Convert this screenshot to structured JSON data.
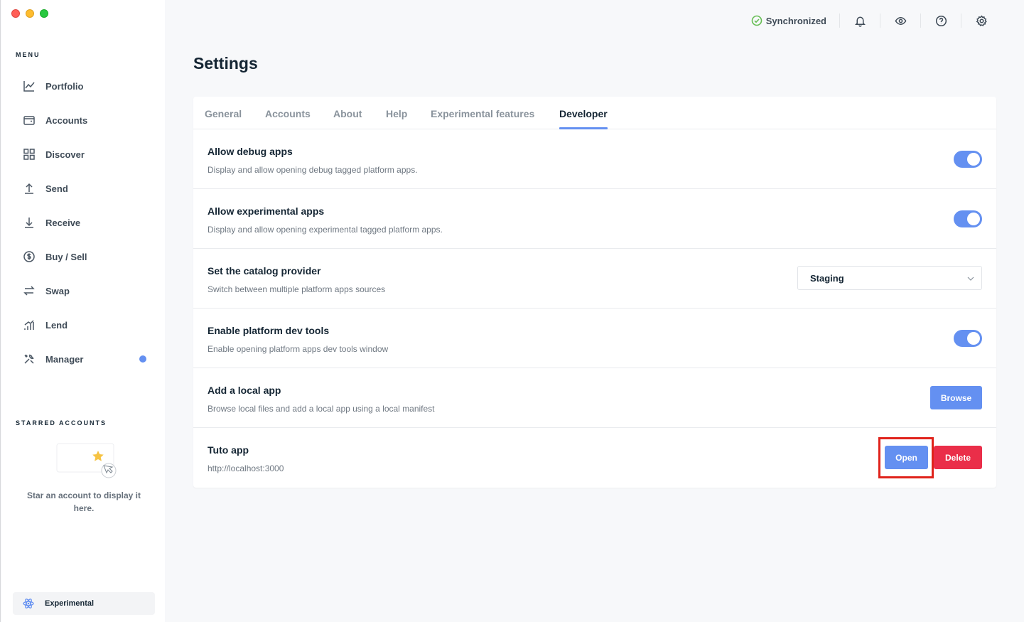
{
  "sidebar": {
    "menu_title": "MENU",
    "items": [
      {
        "label": "Portfolio",
        "icon": "chart-icon"
      },
      {
        "label": "Accounts",
        "icon": "wallet-icon"
      },
      {
        "label": "Discover",
        "icon": "grid-icon"
      },
      {
        "label": "Send",
        "icon": "arrow-up-icon"
      },
      {
        "label": "Receive",
        "icon": "arrow-down-icon"
      },
      {
        "label": "Buy / Sell",
        "icon": "dollar-icon"
      },
      {
        "label": "Swap",
        "icon": "swap-icon"
      },
      {
        "label": "Lend",
        "icon": "lend-icon"
      },
      {
        "label": "Manager",
        "icon": "tools-icon"
      }
    ],
    "starred_title": "STARRED ACCOUNTS",
    "starred_empty_text": "Star an account to display it here.",
    "experimental_label": "Experimental"
  },
  "topbar": {
    "sync_label": "Synchronized"
  },
  "page": {
    "title": "Settings"
  },
  "tabs": [
    "General",
    "Accounts",
    "About",
    "Help",
    "Experimental features",
    "Developer"
  ],
  "active_tab": "Developer",
  "rows": {
    "debug": {
      "title": "Allow debug apps",
      "desc": "Display and allow opening debug tagged platform apps."
    },
    "experimental": {
      "title": "Allow experimental apps",
      "desc": "Display and allow opening experimental tagged platform apps."
    },
    "catalog": {
      "title": "Set the catalog provider",
      "desc": "Switch between multiple platform apps sources",
      "value": "Staging"
    },
    "devtools": {
      "title": "Enable platform dev tools",
      "desc": "Enable opening platform apps dev tools window"
    },
    "local": {
      "title": "Add a local app",
      "desc": "Browse local files and add a local app using a local manifest",
      "button": "Browse"
    },
    "tuto": {
      "title": "Tuto app",
      "desc": "http://localhost:3000",
      "open": "Open",
      "delete": "Delete"
    }
  },
  "colors": {
    "accent": "#6490f1",
    "danger": "#ea2e49",
    "success": "#66be54",
    "highlight": "#e0231b"
  }
}
